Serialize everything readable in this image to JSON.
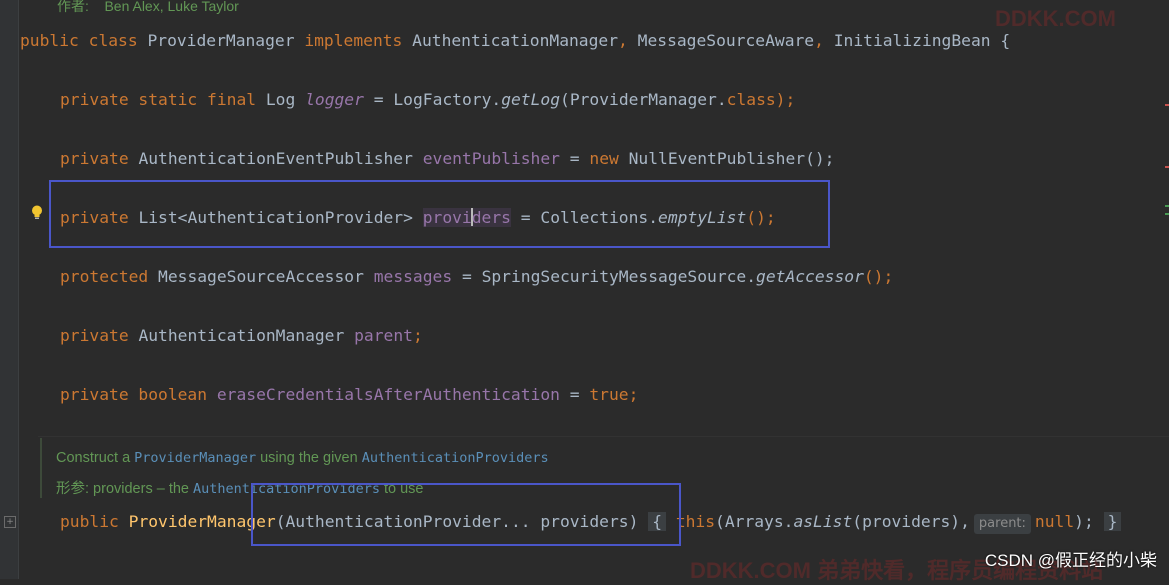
{
  "doc_header": {
    "author_label": "作者:",
    "author_value": "Ben Alex, Luke Taylor"
  },
  "code": {
    "class_decl": {
      "kw1": "public",
      "kw2": "class",
      "name": "ProviderManager",
      "kw3": "implements",
      "iface1": "AuthenticationManager",
      "iface2": "MessageSourceAware",
      "iface3": "InitializingBean",
      "brace": "{"
    },
    "logger_line": {
      "mods": "private static final",
      "type": "Log",
      "name": "logger",
      "eq": "=",
      "call_cls": "LogFactory.",
      "call_m": "getLog",
      "args_open": "(ProviderManager.",
      "args_kw": "class",
      "args_close": ");"
    },
    "publisher_line": {
      "mods": "private",
      "type": "AuthenticationEventPublisher",
      "name": "eventPublisher",
      "eq": "=",
      "new_kw": "new",
      "ctor": "NullEventPublisher();"
    },
    "providers_line": {
      "mods": "private",
      "type": "List<AuthenticationProvider>",
      "name_a": "provi",
      "name_b": "ders",
      "eq": "=",
      "call_cls": "Collections.",
      "call_m": "emptyList",
      "close": "();"
    },
    "messages_line": {
      "mods": "protected",
      "type": "MessageSourceAccessor",
      "name": "messages",
      "eq": "=",
      "call_cls": "SpringSecurityMessageSource.",
      "call_m": "getAccessor",
      "close": "();"
    },
    "parent_line": {
      "mods": "private",
      "type": "AuthenticationManager",
      "name": "parent",
      "semi": ";"
    },
    "erase_line": {
      "mods": "private boolean",
      "name": "eraseCredentialsAfterAuthentication",
      "eq": "=",
      "val": "true",
      "semi": ";"
    },
    "javadoc": {
      "line1_a": "Construct a ",
      "line1_code1": "ProviderManager",
      "line1_b": " using the given ",
      "line1_code2": "AuthenticationProviders",
      "line2_label": "形参:",
      "line2_param": " providers",
      "line2_a": " – the ",
      "line2_code": "AuthenticationProviders",
      "line2_b": " to use"
    },
    "ctor_line": {
      "mods": "public",
      "name": "ProviderManager",
      "params": "(AuthenticationProvider... providers)",
      "brace_open": "{",
      "this_kw": "this",
      "call_a": "(Arrays.",
      "call_m": "asList",
      "call_b": "(providers),",
      "hint_label": "parent:",
      "null_kw": "null",
      "close": ");",
      "brace_close": "}"
    }
  },
  "watermarks": {
    "top": "DDKK.COM",
    "bottom": "DDKK.COM 弟弟快看，程序员编程资料站"
  },
  "credit": "CSDN @假正经的小柴",
  "colors": {
    "background": "#2b2b2b",
    "keyword": "#cc7832",
    "field": "#9876aa",
    "method_decl": "#ffc66d",
    "highlight_box": "#4a56c9",
    "doc": "#629755"
  }
}
